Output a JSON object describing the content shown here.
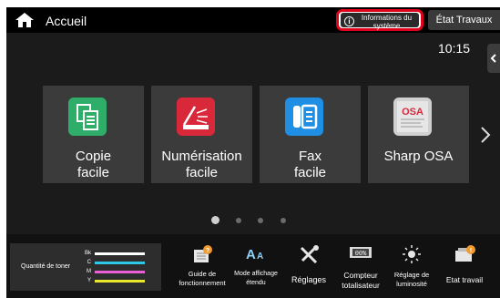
{
  "header": {
    "home_label": "Accueil",
    "system_info_label": "Informations du système",
    "job_status_label": "État Travaux",
    "clock": "10:15"
  },
  "tiles": [
    {
      "label_line1": "Copie",
      "label_line2": "facile",
      "icon": "copy-icon",
      "color": "#2fae6a"
    },
    {
      "label_line1": "Numérisation",
      "label_line2": "facile",
      "icon": "scan-icon",
      "color": "#d8283a"
    },
    {
      "label_line1": "Fax",
      "label_line2": "facile",
      "icon": "fax-icon",
      "color": "#1f8fe3"
    },
    {
      "label_line1": "Sharp OSA",
      "label_line2": "",
      "icon": "sharp-osa-icon",
      "color": "#d0d0d0"
    }
  ],
  "pager": {
    "count": 4,
    "active": 0
  },
  "toner": {
    "label": "Quantité de toner",
    "rows": [
      {
        "code": "Bk",
        "color": "#ffffff",
        "level": 1.0
      },
      {
        "code": "C",
        "color": "#2ec8e8",
        "level": 1.0
      },
      {
        "code": "M",
        "color": "#e85fd6",
        "level": 1.0
      },
      {
        "code": "Y",
        "color": "#e9e62e",
        "level": 1.0
      }
    ]
  },
  "bottom_bar": {
    "guide_line1": "Guide de",
    "guide_line2": "fonctionnement",
    "display_line1": "Mode affichage",
    "display_line2": "étendu",
    "settings": "Réglages",
    "counter_line1": "Compteur",
    "counter_line2": "totalisateur",
    "brightness_line1": "Réglage de",
    "brightness_line2": "luminosité",
    "job_status": "Etat travail",
    "counter_display": "00%"
  },
  "colors": {
    "accent_red": "#e0001b",
    "badge_orange": "#f29a2e"
  }
}
